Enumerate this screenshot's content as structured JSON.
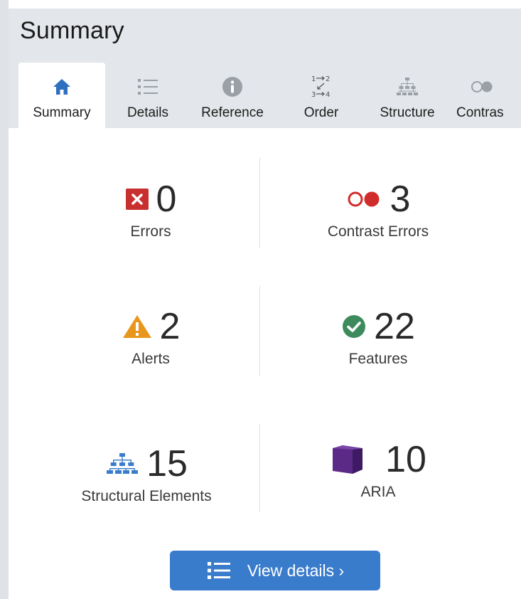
{
  "header": {
    "title": "Summary"
  },
  "tabs": [
    {
      "label": "Summary",
      "icon": "home-icon",
      "active": true
    },
    {
      "label": "Details",
      "icon": "list-icon",
      "active": false
    },
    {
      "label": "Reference",
      "icon": "info-icon",
      "active": false
    },
    {
      "label": "Order",
      "icon": "order-icon",
      "active": false
    },
    {
      "label": "Structure",
      "icon": "structure-icon",
      "active": false
    },
    {
      "label": "Contras",
      "icon": "contrast-icon",
      "active": false
    }
  ],
  "stats": {
    "errors": {
      "value": "0",
      "label": "Errors",
      "icon": "error-icon",
      "color": "#c8302f"
    },
    "contrast_errors": {
      "value": "3",
      "label": "Contrast Errors",
      "icon": "contrast-icon",
      "color": "#d12c2c"
    },
    "alerts": {
      "value": "2",
      "label": "Alerts",
      "icon": "warning-icon",
      "color": "#e8961c"
    },
    "features": {
      "value": "22",
      "label": "Features",
      "icon": "check-icon",
      "color": "#3d8a5c"
    },
    "structural": {
      "value": "15",
      "label": "Structural Elements",
      "icon": "structure-icon",
      "color": "#3a7ccc"
    },
    "aria": {
      "value": "10",
      "label": "ARIA",
      "icon": "aria-cube-icon",
      "color": "#5b2a86"
    }
  },
  "actions": {
    "view_details_label": "View details ›"
  },
  "colors": {
    "accent": "#3a7ccc",
    "tab_icon_gray": "#9aa0a6",
    "home_blue": "#2f6fc0"
  }
}
